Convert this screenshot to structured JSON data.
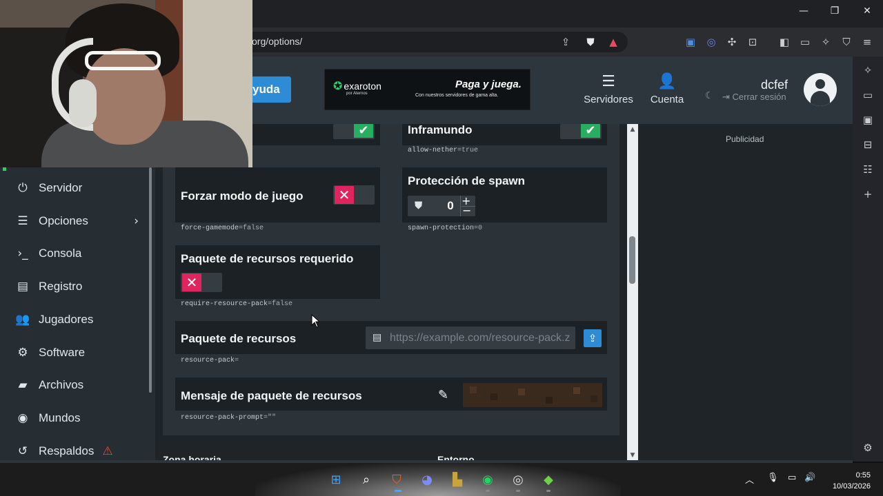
{
  "browser": {
    "url_partial": "org/options/",
    "window_controls": [
      "minimize",
      "restore",
      "close"
    ],
    "toolbar_icons": [
      "share-icon",
      "brave-shield-icon",
      "brave-rewards-icon"
    ],
    "extension_icons": [
      "extension-1-icon",
      "extension-2-icon",
      "puzzle-icon",
      "screenshot-icon",
      "sidebar-toggle-icon",
      "wallet-icon",
      "leo-icon",
      "vpn-icon",
      "menu-icon"
    ],
    "side_icons": [
      "leo-icon",
      "media-icon",
      "wallet-icon",
      "bookmarks-icon",
      "reading-list-icon",
      "add-icon",
      "settings-icon"
    ]
  },
  "header": {
    "help_label": "yuda",
    "ad": {
      "brand": "exaroton",
      "brand_sub": "por Aternos",
      "headline": "Paga y juega.",
      "subline": "Con nuestros servidores de gama alta."
    },
    "nav": [
      {
        "label": "Servidores",
        "icon": "servers-icon"
      },
      {
        "label": "Cuenta",
        "icon": "account-icon"
      }
    ],
    "username": "dcfef",
    "logout_label": "Cerrar sesión"
  },
  "sidebar": {
    "items": [
      {
        "label": "Servidor",
        "icon": "⏻"
      },
      {
        "label": "Opciones",
        "icon": "☰",
        "chevron": "›"
      },
      {
        "label": "Consola",
        "icon": "›_"
      },
      {
        "label": "Registro",
        "icon": "▤"
      },
      {
        "label": "Jugadores",
        "icon": "👥"
      },
      {
        "label": "Software",
        "icon": "⚙"
      },
      {
        "label": "Archivos",
        "icon": "▰"
      },
      {
        "label": "Mundos",
        "icon": "◉"
      },
      {
        "label": "Respaldos",
        "icon": "↺",
        "warning": "⚠"
      }
    ]
  },
  "options": {
    "top_left_key": "",
    "inframundo": {
      "title": "Inframundo",
      "key": "allow-nether",
      "value": "=true",
      "enabled": true
    },
    "force_gamemode": {
      "title": "Forzar modo de juego",
      "key": "force-gamemode",
      "value": "=false",
      "enabled": false
    },
    "spawn_protection": {
      "title": "Protección de spawn",
      "key": "spawn-protection",
      "value": "=0",
      "number": "0"
    },
    "require_resource_pack": {
      "title": "Paquete de recursos requerido",
      "key": "require-resource-pack",
      "value": "=false",
      "enabled": false
    },
    "resource_pack": {
      "title": "Paquete de recursos",
      "key": "resource-pack",
      "value": "=",
      "placeholder": "https://example.com/resource-pack.zip"
    },
    "resource_pack_prompt": {
      "title": "Mensaje de paquete de recursos",
      "key": "resource-pack-prompt",
      "value": "=\"\""
    },
    "next_sections": [
      "Zona horaria",
      "Entorno"
    ]
  },
  "right_column": {
    "ad_label": "Publicidad"
  },
  "taskbar": {
    "apps": [
      "windows-start-icon",
      "search-icon",
      "brave-icon",
      "discord-icon",
      "league-icon",
      "spotify-icon",
      "obs-icon",
      "minecraft-icon"
    ],
    "time": "0:55",
    "date": "10/03/2026"
  },
  "colors": {
    "accent_blue": "#2e8bd6",
    "toggle_on": "#27ae60",
    "toggle_off": "#e0245e",
    "panel": "#2b3338",
    "card": "#1b2125"
  }
}
